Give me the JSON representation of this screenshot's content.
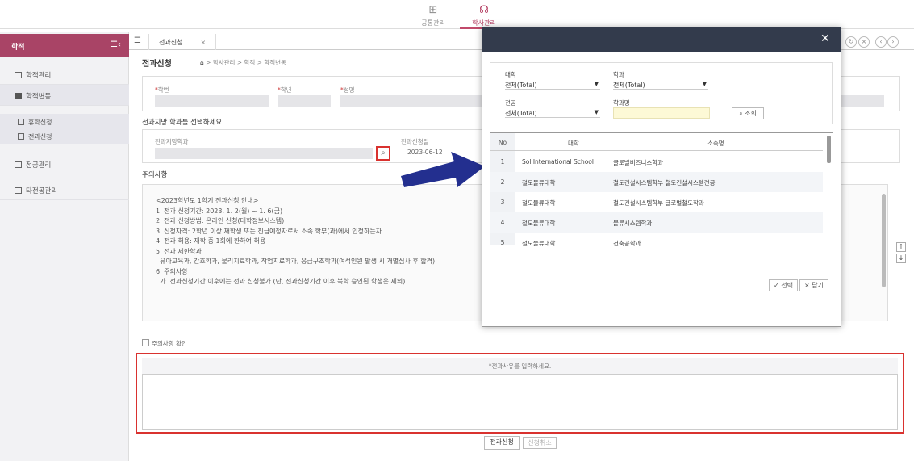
{
  "topnav": [
    {
      "icon": "grid-icon",
      "label": "공통관리"
    },
    {
      "icon": "graduation-cap-icon",
      "label": "학사관리"
    }
  ],
  "sidebar": {
    "title": "학적",
    "items": [
      {
        "label": "학적관리"
      },
      {
        "label": "학적변동"
      },
      {
        "label": "전공관리"
      },
      {
        "label": "타전공관리"
      }
    ],
    "subitems": [
      {
        "label": "휴학신청"
      },
      {
        "label": "전과신청"
      }
    ]
  },
  "tab": {
    "label": "전과신청",
    "close": "×"
  },
  "page": {
    "title": "전과신청",
    "breadcrumb": "학사관리 > 학적 > 학적변동"
  },
  "student": {
    "fields": [
      {
        "label": "학번"
      },
      {
        "label": "학년"
      },
      {
        "label": "성명"
      }
    ]
  },
  "dept": {
    "section": "전과지망 학과를 선택하세요.",
    "dept_label": "전과지망학과",
    "date_label": "전과신청일",
    "date_value": "2023-06-12"
  },
  "notice": {
    "section": "주의사항",
    "lines": [
      "<2023학년도 1학기 전과신청 안내>",
      "",
      "1. 전과 신청기간: 2023. 1. 2(월) ~ 1. 6(금)",
      "2. 전과 신청방법: 온라인 신청(대학정보시스템)",
      "3. 신청자격: 2학년 이상 재학생 또는 진급예정자로서 소속 학부(과)에서 인정하는자",
      "4. 전과 허용: 재학 중 1회에 한하여 허용",
      "5. 전과 제한학과",
      "  유아교육과, 간호학과, 물리치료학과, 작업치료학과, 응급구조학과(여석인원 발생 시 개별심사 후 합격)",
      "",
      "6. 주의사항",
      "  가. 전과신청기간 이후에는 전과 신청불가.(단, 전과신청기간 이후 복학 승인된 학생은 제외)"
    ],
    "confirm": "주의사항 확인"
  },
  "reason": {
    "header": "*전과사유를 입력하세요."
  },
  "buttons": {
    "apply": "전과신청",
    "cancel": "신청취소"
  },
  "modal": {
    "filters": {
      "college_label": "대학",
      "college_value": "전체(Total)",
      "dept_label": "학과",
      "dept_value": "전체(Total)",
      "major_label": "전공",
      "major_value": "전체(Total)",
      "deptname_label": "학과명",
      "deptname_value": "",
      "search": "조회"
    },
    "columns": [
      "No",
      "대학",
      "소속명"
    ],
    "rows": [
      {
        "no": "1",
        "college": "Sol International School",
        "org": "글로벌비즈니스학과"
      },
      {
        "no": "2",
        "college": "철도물류대학",
        "org": "철도건설시스템학부 철도건설시스템전공"
      },
      {
        "no": "3",
        "college": "철도물류대학",
        "org": "철도건설시스템학부 글로벌철도학과"
      },
      {
        "no": "4",
        "college": "철도물류대학",
        "org": "물류시스템학과"
      },
      {
        "no": "5",
        "college": "철도물류대학",
        "org": "건축공학과"
      }
    ],
    "select": "선택",
    "close": "닫기"
  },
  "colors": {
    "brand": "#a94466",
    "modal_header": "#333b4c",
    "highlight": "#d9322f",
    "arrow": "#232f8f"
  }
}
